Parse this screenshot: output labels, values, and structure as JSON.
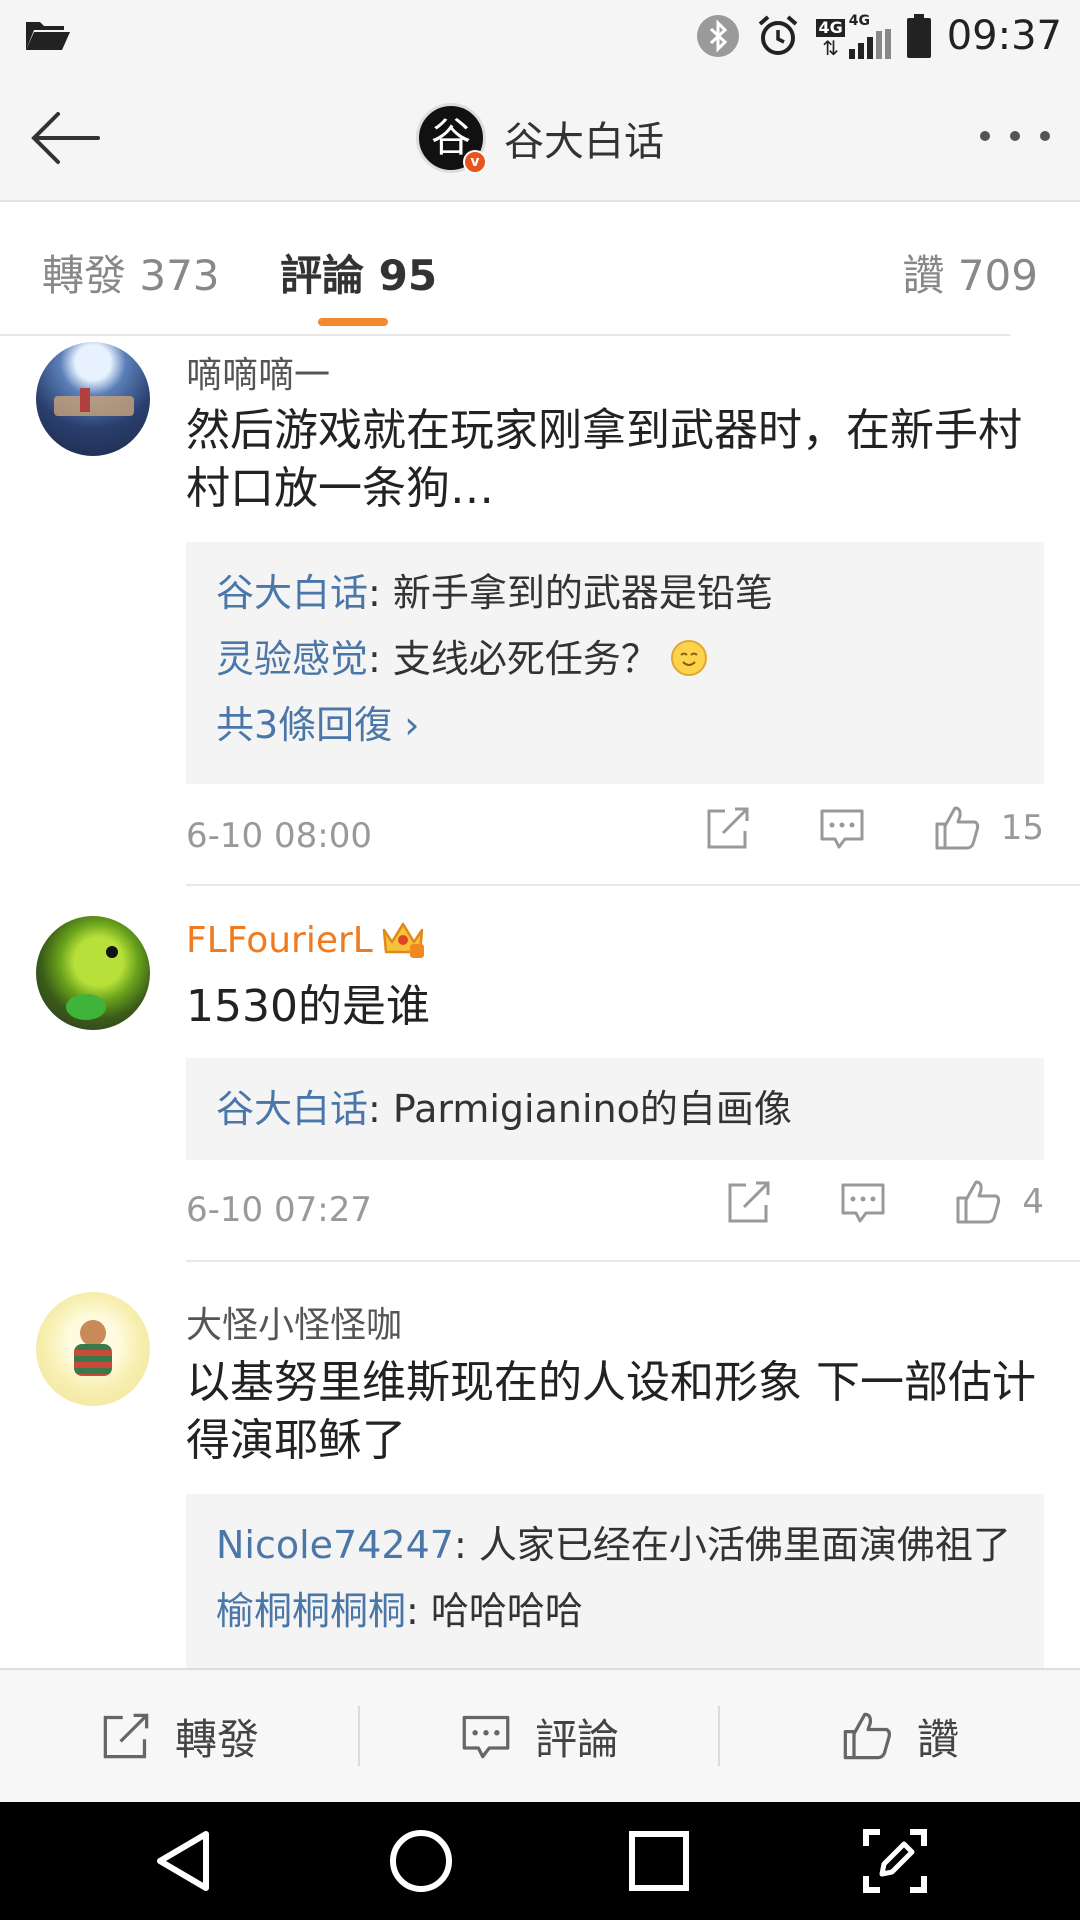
{
  "status_bar": {
    "time": "09:37",
    "net1": "4G",
    "net2": "4G"
  },
  "nav": {
    "title": "谷大白话",
    "avatar_glyph": "谷",
    "verified_badge": "v"
  },
  "tabs": {
    "repost": "轉發 373",
    "comment": "評論 95",
    "like": "讚 709"
  },
  "colors": {
    "accent": "#f28a2e",
    "link": "#4a76a8",
    "vip_name": "#f07a1e"
  },
  "comments": [
    {
      "name": "嘀嘀嘀一",
      "text": "然后游戏就在玩家刚拿到武器时，在新手村村口放一条狗…",
      "replies": [
        {
          "name": "谷大白话",
          "sep": ": ",
          "text": "新手拿到的武器是铅笔"
        },
        {
          "name": "灵验感觉",
          "sep": ": ",
          "text": "支线必死任务？"
        }
      ],
      "more": "共3條回復 ›",
      "time": "6-10 08:00",
      "likes": "15"
    },
    {
      "name": "FLFourierL",
      "text": "1530的是谁",
      "replies": [
        {
          "name": "谷大白话",
          "sep": ": ",
          "text": "Parmigianino的自画像"
        }
      ],
      "time": "6-10 07:27",
      "likes": "4"
    },
    {
      "name": "大怪小怪怪咖",
      "text": "以基努里维斯现在的人设和形象 下一部估计得演耶稣了",
      "replies": [
        {
          "name": "Nicole74247",
          "sep": ": ",
          "text": "人家已经在小活佛里面演佛祖了"
        },
        {
          "name": "榆桐桐桐桐",
          "sep": ": ",
          "text": "哈哈哈哈"
        }
      ]
    }
  ],
  "bottom_bar": {
    "repost": "轉發",
    "comment": "評論",
    "like": "讚"
  }
}
